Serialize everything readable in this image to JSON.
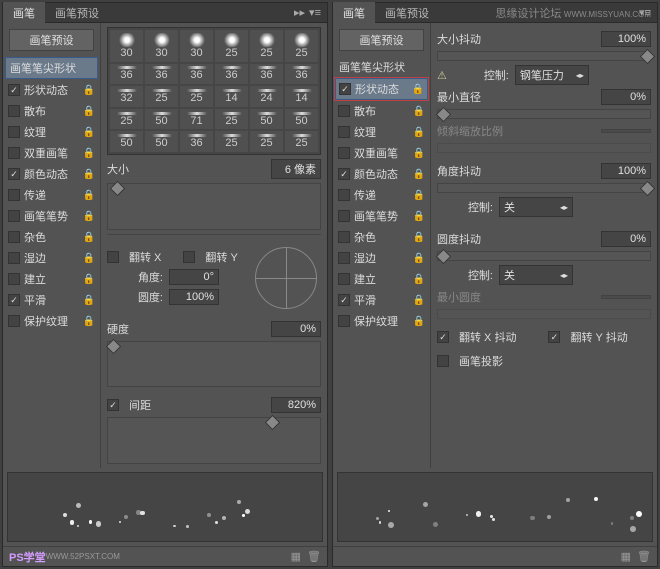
{
  "watermark": {
    "line1": "思缘设计论坛",
    "line2": "WWW.MISSYUAN.COM"
  },
  "tabs": {
    "brush": "画笔",
    "preset": "画笔预设"
  },
  "preset_button": "画笔预设",
  "sidebar_items": [
    {
      "label": "画笔笔尖形状",
      "checked": null,
      "locked": false
    },
    {
      "label": "形状动态",
      "checked": true,
      "locked": true
    },
    {
      "label": "散布",
      "checked": false,
      "locked": true
    },
    {
      "label": "纹理",
      "checked": false,
      "locked": true
    },
    {
      "label": "双重画笔",
      "checked": false,
      "locked": true
    },
    {
      "label": "颜色动态",
      "checked": true,
      "locked": true
    },
    {
      "label": "传递",
      "checked": false,
      "locked": true
    },
    {
      "label": "画笔笔势",
      "checked": false,
      "locked": true
    },
    {
      "label": "杂色",
      "checked": false,
      "locked": true
    },
    {
      "label": "湿边",
      "checked": false,
      "locked": true
    },
    {
      "label": "建立",
      "checked": false,
      "locked": true
    },
    {
      "label": "平滑",
      "checked": true,
      "locked": true
    },
    {
      "label": "保护纹理",
      "checked": false,
      "locked": true
    }
  ],
  "left": {
    "brush_sizes_rows": [
      {
        "style": "soft",
        "vals": [
          30,
          30,
          30,
          25,
          25,
          25
        ]
      },
      {
        "style": "line",
        "vals": [
          36,
          36,
          36,
          36,
          36,
          36
        ]
      },
      {
        "style": "line",
        "vals": [
          32,
          25,
          25,
          14,
          24,
          14
        ]
      },
      {
        "style": "line",
        "vals": [
          25,
          50,
          71,
          25,
          50,
          50
        ]
      },
      {
        "style": "line",
        "vals": [
          50,
          50,
          36,
          25,
          25,
          25
        ]
      }
    ],
    "size_label": "大小",
    "size_value": "6 像素",
    "flip_x": "翻转 X",
    "flip_y": "翻转 Y",
    "angle_label": "角度:",
    "angle_value": "0°",
    "round_label": "圆度:",
    "round_value": "100%",
    "hardness_label": "硬度",
    "hardness_value": "0%",
    "spacing_label": "间距",
    "spacing_value": "820%"
  },
  "right": {
    "size_jitter": {
      "label": "大小抖动",
      "value": "100%"
    },
    "control1": {
      "label": "控制:",
      "value": "钢笔压力"
    },
    "min_diam": {
      "label": "最小直径",
      "value": "0%"
    },
    "tilt_scale": "倾斜缩放比例",
    "angle_jitter": {
      "label": "角度抖动",
      "value": "100%"
    },
    "control2": {
      "label": "控制:",
      "value": "关"
    },
    "round_jitter": {
      "label": "圆度抖动",
      "value": "0%"
    },
    "control3": {
      "label": "控制:",
      "value": "关"
    },
    "min_round": "最小圆度",
    "flip_x_jitter": "翻转 X 抖动",
    "flip_y_jitter": "翻转 Y 抖动",
    "brush_proj": "画笔投影"
  },
  "footer_watermark": {
    "a": "PS学堂",
    "b": "WWW.52PSXT.COM"
  }
}
